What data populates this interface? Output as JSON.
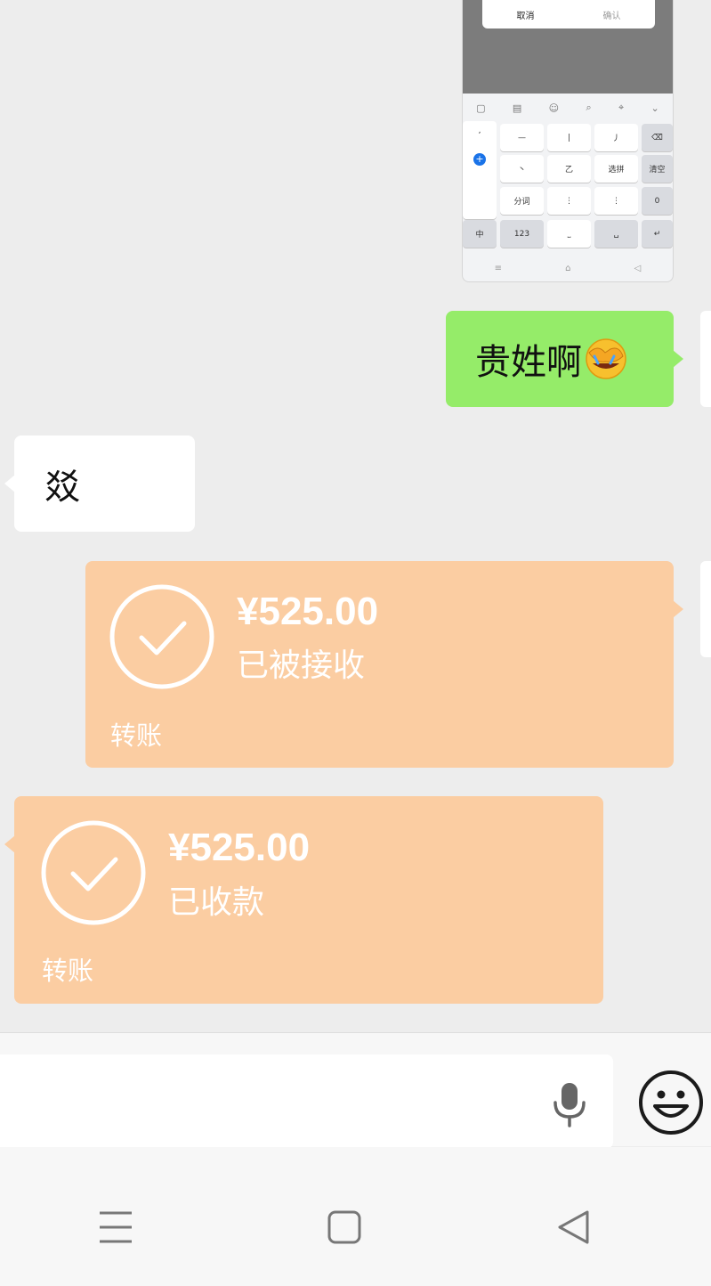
{
  "image_message": {
    "dialog_cancel": "取消",
    "dialog_confirm": "确认",
    "keys": {
      "segment": "分词",
      "num": "123",
      "clear": "清空",
      "zero": "0",
      "fuzzy": "选拼",
      "lang": "中"
    }
  },
  "messages": {
    "sent_text": "贵姓啊",
    "received_text": "㸚"
  },
  "transfers": [
    {
      "amount": "¥525.00",
      "status": "已被接收",
      "kind": "转账"
    },
    {
      "amount": "¥525.00",
      "status": "已收款",
      "kind": "转账"
    }
  ],
  "input_bar": {
    "placeholder": ""
  },
  "colors": {
    "chat_bg": "#ededed",
    "sent_bubble": "#95ec69",
    "transfer_card": "#fbcda2"
  }
}
